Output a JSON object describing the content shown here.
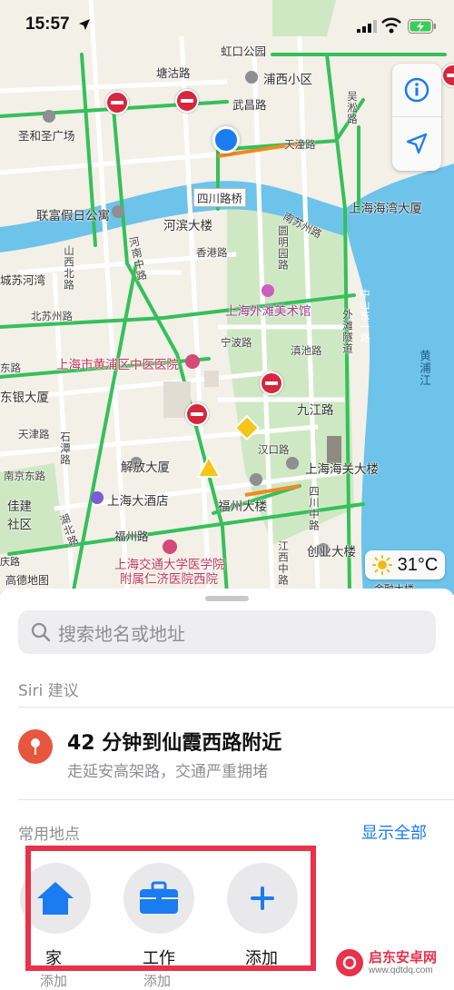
{
  "status_bar": {
    "time": "15:57"
  },
  "map": {
    "labels": {
      "l1": "虹口公园",
      "l2": "塘沽路",
      "l3": "浦西小区",
      "l4": "武昌路",
      "l5": "圣和圣广场",
      "l6": "吴淞路",
      "l7": "天潼路",
      "l8": "四川路桥",
      "l9": "上海海湾大厦",
      "l10": "联富假日公寓",
      "l11": "河滨大楼",
      "l12": "南苏州路",
      "l13": "山西北路",
      "l14": "香港路",
      "l15": "圆明园路",
      "l16": "河南中路",
      "l17": "城苏河湾",
      "l18": "北苏州路",
      "l19": "上海外滩美术馆",
      "l20": "宁波路",
      "l21": "滇池路",
      "l22": "中山东一路",
      "l23": "外滩隧道",
      "l24": "黄浦江",
      "l25": "上海市黄浦区中医医院",
      "l26": "九江路",
      "l27": "东路",
      "l28": "东银大厦",
      "l29": "天津路",
      "l30": "石潭路",
      "l31": "汉口路",
      "l32": "上海海关大楼",
      "l33": "南京东路",
      "l34": "解放大厦",
      "l35": "佳建",
      "l36": "社区",
      "l37": "上海大酒店",
      "l38": "福州大楼",
      "l39": "四川中路",
      "l40": "湖北路",
      "l41": "福州路",
      "l42": "创业大楼",
      "l43": "江西中路",
      "l44": "上海交通大学医学院",
      "l45": "附属仁济医院西院",
      "l46": "高德地图",
      "l47": "金融大楼",
      "l48": "庆路"
    },
    "weather": {
      "temp": "31°C"
    }
  },
  "sheet": {
    "search_placeholder": "搜索地名或地址",
    "siri_label": "Siri 建议",
    "suggestion": {
      "title": "42 分钟到仙霞西路附近",
      "subtitle": "走延安高架路，交通严重拥堵"
    },
    "favorites_label": "常用地点",
    "show_all": "显示全部",
    "favorites": [
      {
        "label": "家",
        "sub": "添加"
      },
      {
        "label": "工作",
        "sub": "添加"
      },
      {
        "label": "添加"
      }
    ]
  },
  "watermark": {
    "title": "启东安卓网",
    "url": "www.qdtdq.com"
  },
  "colors": {
    "accent": "#1a7cf0",
    "highlight": "#e8314a",
    "road_green": "#35c05a"
  }
}
